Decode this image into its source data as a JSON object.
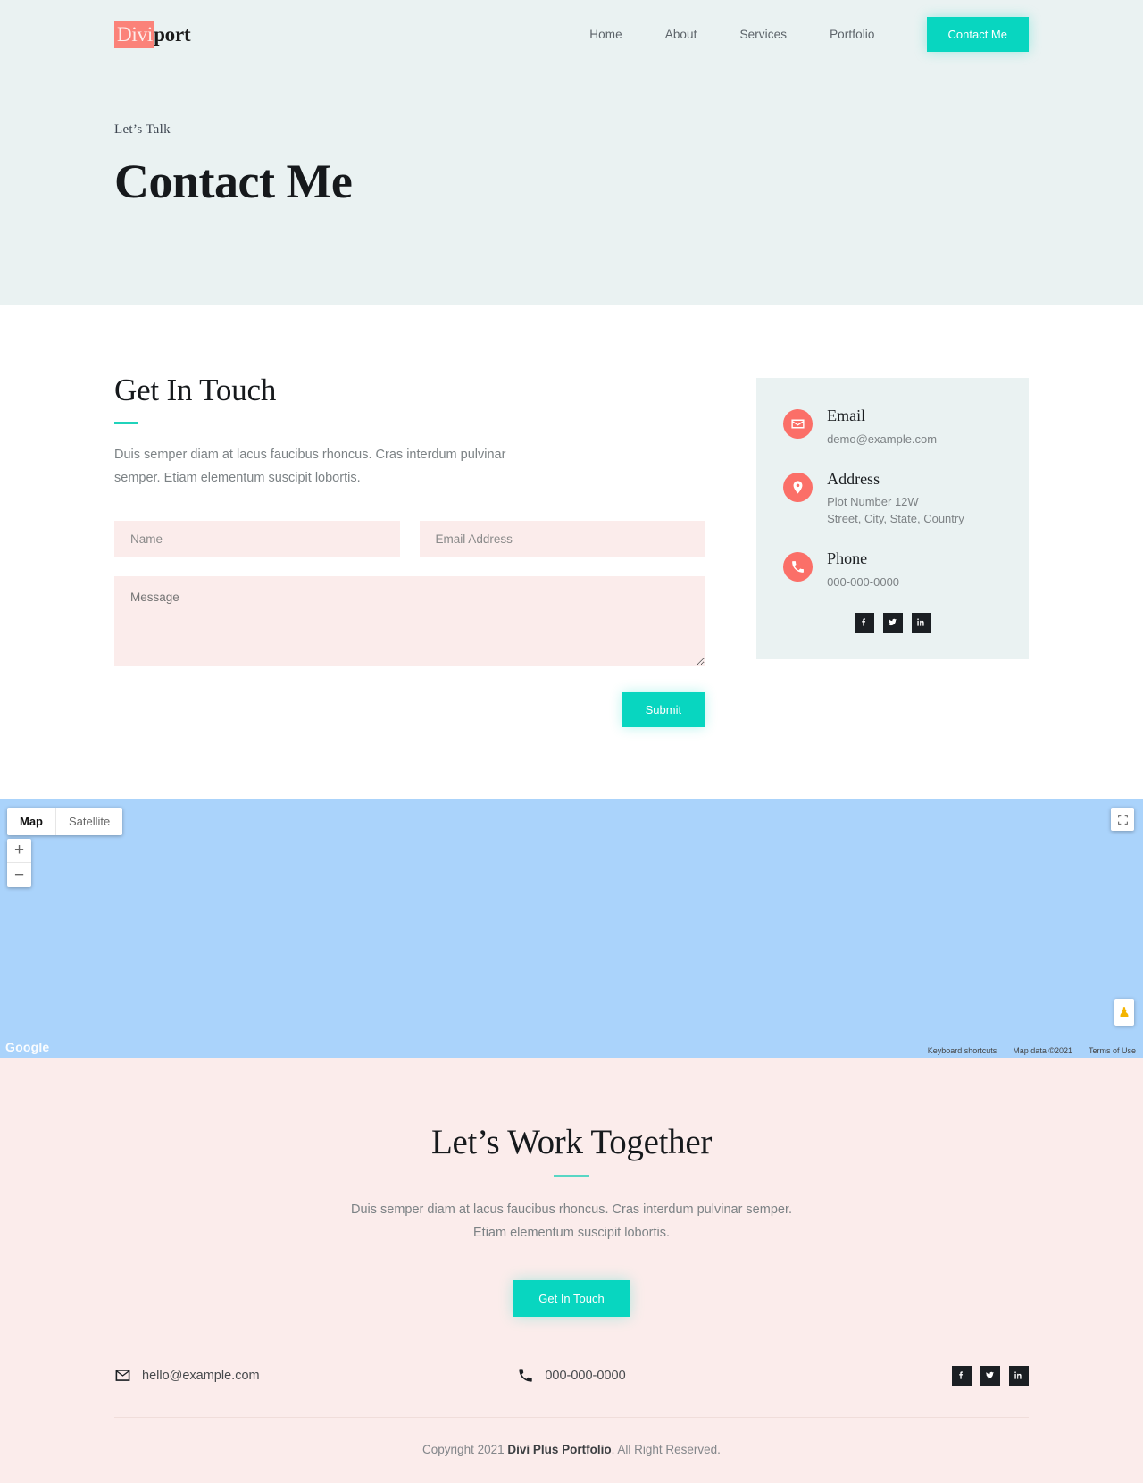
{
  "header": {
    "logo_mark": "Divi",
    "logo_rest": "port",
    "nav": [
      {
        "label": "Home"
      },
      {
        "label": "About"
      },
      {
        "label": "Services"
      },
      {
        "label": "Portfolio"
      }
    ],
    "cta_label": "Contact Me"
  },
  "hero": {
    "eyebrow": "Let’s Talk",
    "title": "Contact Me"
  },
  "contact": {
    "title": "Get In Touch",
    "description": "Duis semper diam at lacus faucibus rhoncus. Cras interdum pulvinar semper. Etiam elementum suscipit lobortis.",
    "form": {
      "name_placeholder": "Name",
      "email_placeholder": "Email Address",
      "message_placeholder": "Message",
      "submit_label": "Submit"
    },
    "info": [
      {
        "icon": "envelope-icon",
        "label": "Email",
        "value": "demo@example.com"
      },
      {
        "icon": "map-pin-icon",
        "label": "Address",
        "value": "Plot Number 12W\nStreet, City, State, Country"
      },
      {
        "icon": "phone-icon",
        "label": "Phone",
        "value": "000-000-0000"
      }
    ],
    "socials": [
      {
        "icon": "facebook-icon",
        "name": "Facebook"
      },
      {
        "icon": "twitter-icon",
        "name": "Twitter"
      },
      {
        "icon": "linkedin-icon",
        "name": "LinkedIn"
      }
    ]
  },
  "map": {
    "type_map": "Map",
    "type_satellite": "Satellite",
    "zoom_in": "+",
    "zoom_out": "−",
    "watermark": "Google",
    "legal": [
      {
        "label": "Keyboard shortcuts"
      },
      {
        "label": "Map data ©2021"
      },
      {
        "label": "Terms of Use"
      }
    ]
  },
  "cta": {
    "title": "Let’s Work Together",
    "text_line1": "Duis semper diam at lacus faucibus rhoncus. Cras interdum pulvinar semper.",
    "text_line2": "Etiam elementum suscipit lobortis.",
    "button_label": "Get In Touch"
  },
  "footer": {
    "email": "hello@example.com",
    "phone": "000-000-0000",
    "socials": [
      {
        "icon": "facebook-icon",
        "name": "Facebook"
      },
      {
        "icon": "twitter-icon",
        "name": "Twitter"
      },
      {
        "icon": "linkedin-icon",
        "name": "LinkedIn"
      }
    ],
    "copyright_prefix": "Copyright 2021 ",
    "copyright_brand": "Divi Plus Portfolio",
    "copyright_suffix": ". All Right Reserved."
  },
  "colors": {
    "accent_teal": "#08d6c0",
    "coral": "#fb6f68",
    "hero_bg": "#eaf2f2",
    "pink_bg": "#fbeceb",
    "dark": "#1b1f23"
  }
}
